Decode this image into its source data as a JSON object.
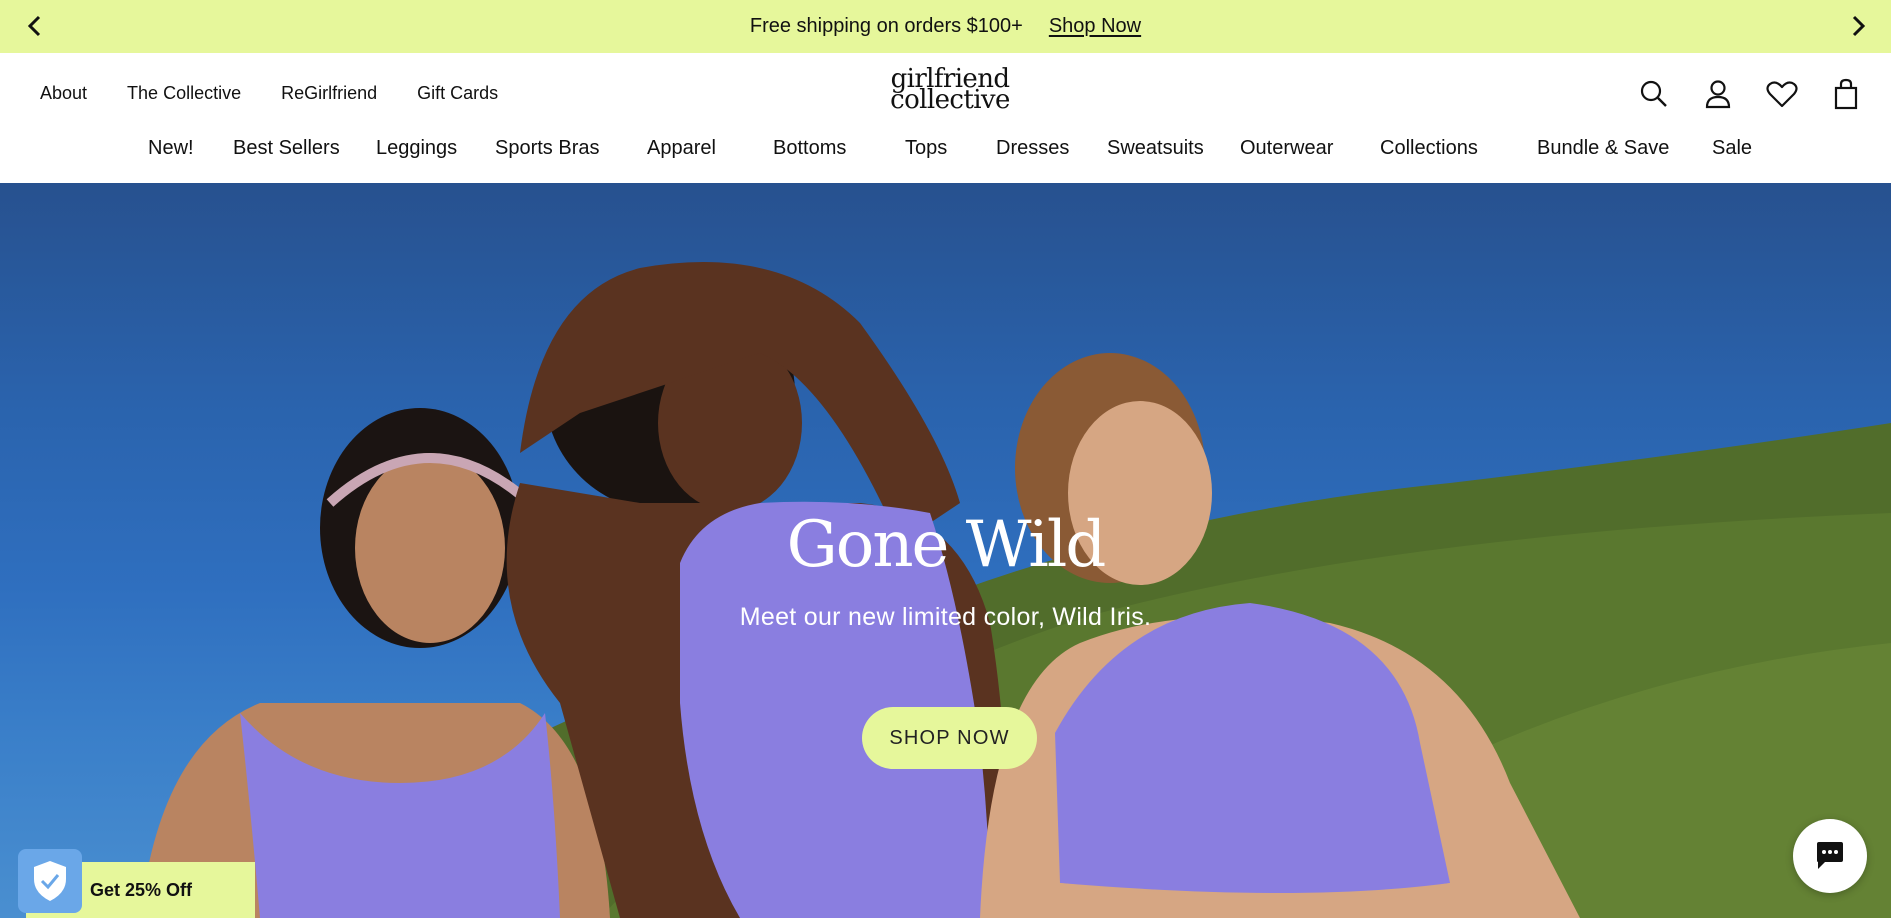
{
  "announcement": {
    "message": "Free shipping on orders $100+",
    "link": "Shop Now",
    "prev_icon": "chevron-left-icon",
    "next_icon": "chevron-right-icon"
  },
  "utility_nav": [
    "About",
    "The Collective",
    "ReGirlfriend",
    "Gift Cards"
  ],
  "logo": {
    "line1": "girlfriend",
    "line2": "collective"
  },
  "header_icons": [
    "search-icon",
    "account-icon",
    "wishlist-heart-icon",
    "cart-bag-icon"
  ],
  "main_nav": [
    "New!",
    "Best Sellers",
    "Leggings",
    "Sports Bras",
    "Apparel",
    "Bottoms",
    "Tops",
    "Dresses",
    "Sweatsuits",
    "Outerwear",
    "Collections",
    "Bundle & Save",
    "Sale"
  ],
  "hero": {
    "title": "Gone Wild",
    "subtitle": "Meet our new limited color, Wild Iris.",
    "cta": "SHOP NOW"
  },
  "promo": {
    "label": "Get 25% Off",
    "icon": "shield-check-icon"
  },
  "chat": {
    "icon": "chat-bubble-icon"
  },
  "colors": {
    "accent": "#e6f79b",
    "sky": "#2a63ad",
    "grass": "#4f6b2a",
    "wild_iris": "#8a7ee0",
    "text": "#111111"
  }
}
